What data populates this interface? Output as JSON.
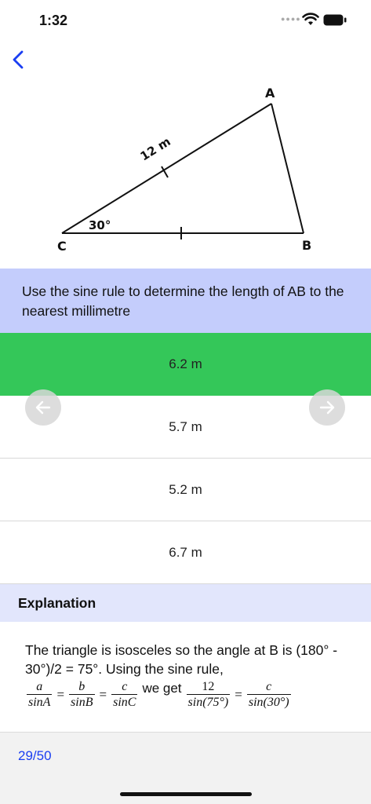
{
  "status_bar": {
    "time": "1:32",
    "signal_icon": "signal-dots-icon",
    "wifi_icon": "wifi-icon",
    "battery_icon": "battery-icon"
  },
  "nav": {
    "back_icon": "chevron-left-icon",
    "accent_color": "#1a3ef2"
  },
  "diagram": {
    "vertex_a": "A",
    "vertex_b": "B",
    "vertex_c": "C",
    "side_label": "12 m",
    "angle_label": "30°"
  },
  "question": {
    "text": "Use the sine rule to determine the length of AB to the nearest millimetre"
  },
  "options": [
    {
      "label": "6.2 m",
      "state": "correct"
    },
    {
      "label": "5.7 m",
      "state": "default"
    },
    {
      "label": "5.2 m",
      "state": "default"
    },
    {
      "label": "6.7 m",
      "state": "default"
    }
  ],
  "colors": {
    "correct": "#34c759",
    "question_bg": "#c4cdfc",
    "explanation_header_bg": "#e2e6fc"
  },
  "arrows": {
    "prev_icon": "arrow-left-icon",
    "next_icon": "arrow-right-icon"
  },
  "explanation": {
    "title": "Explanation",
    "text": "The triangle is isosceles so the angle at B is (180° - 30°)/2 = 75°. Using the sine rule,",
    "formula": {
      "f1_num": "a",
      "f1_den": "sinA",
      "f2_num": "b",
      "f2_den": "sinB",
      "f3_num": "c",
      "f3_den": "sinC",
      "eq": "=",
      "we_get": "we get",
      "f4_num": "12",
      "f4_den": "sin(75°)",
      "f5_num": "c",
      "f5_den": "sin(30°)"
    }
  },
  "footer": {
    "page_indicator": "29/50"
  }
}
